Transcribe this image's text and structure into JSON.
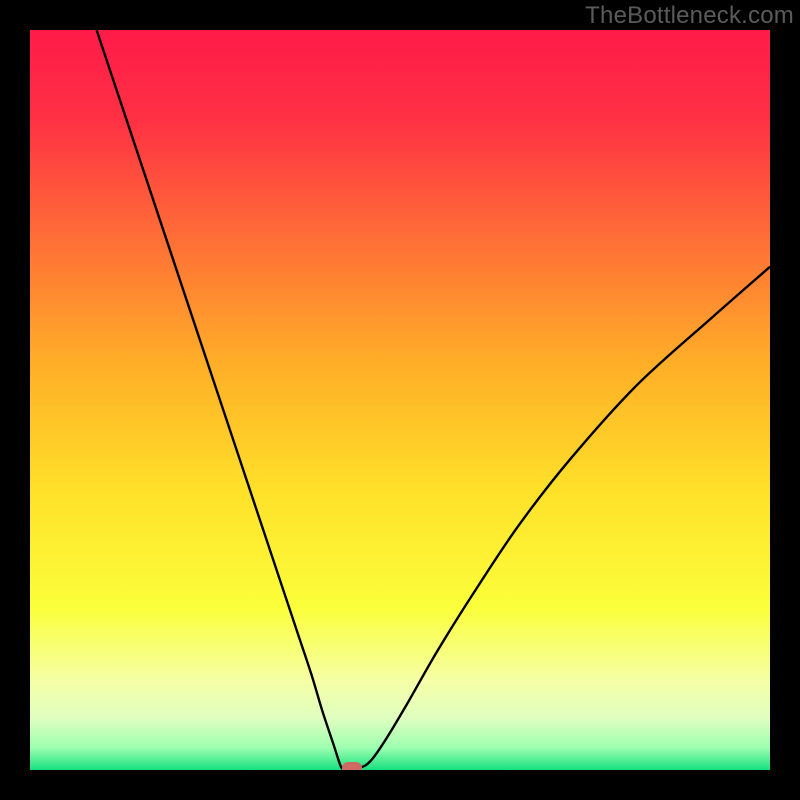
{
  "watermark": "TheBottleneck.com",
  "chart_data": {
    "type": "line",
    "title": "",
    "xlabel": "",
    "ylabel": "",
    "xlim": [
      0,
      100
    ],
    "ylim": [
      0,
      100
    ],
    "grid": false,
    "legend_position": "none",
    "background_gradient": {
      "type": "vertical",
      "stops": [
        {
          "offset": 0.0,
          "color": "#ff1b49"
        },
        {
          "offset": 0.12,
          "color": "#ff3044"
        },
        {
          "offset": 0.3,
          "color": "#ff7535"
        },
        {
          "offset": 0.45,
          "color": "#ffae28"
        },
        {
          "offset": 0.62,
          "color": "#ffe029"
        },
        {
          "offset": 0.78,
          "color": "#fbff3a"
        },
        {
          "offset": 0.88,
          "color": "#f5ffa6"
        },
        {
          "offset": 0.93,
          "color": "#e0ffc0"
        },
        {
          "offset": 0.97,
          "color": "#9dffb0"
        },
        {
          "offset": 1.0,
          "color": "#16e07e"
        }
      ]
    },
    "series": [
      {
        "name": "bottleneck-curve",
        "color": "#000000",
        "x": [
          9,
          12,
          16,
          20,
          24,
          28,
          31,
          34,
          36,
          38,
          39.5,
          41,
          42,
          42.5,
          44.5,
          46,
          48,
          51,
          55,
          60,
          66,
          73,
          82,
          92,
          100
        ],
        "y": [
          100,
          91,
          79,
          67,
          55,
          43,
          34,
          25,
          19,
          13,
          8,
          3.5,
          0.5,
          0.3,
          0.3,
          1.2,
          4,
          9,
          16,
          24,
          33,
          42,
          52,
          61,
          68
        ]
      }
    ],
    "marker": {
      "x": 43.5,
      "y": 0.3,
      "color": "#cf6a62",
      "label": "optimal-point"
    }
  }
}
